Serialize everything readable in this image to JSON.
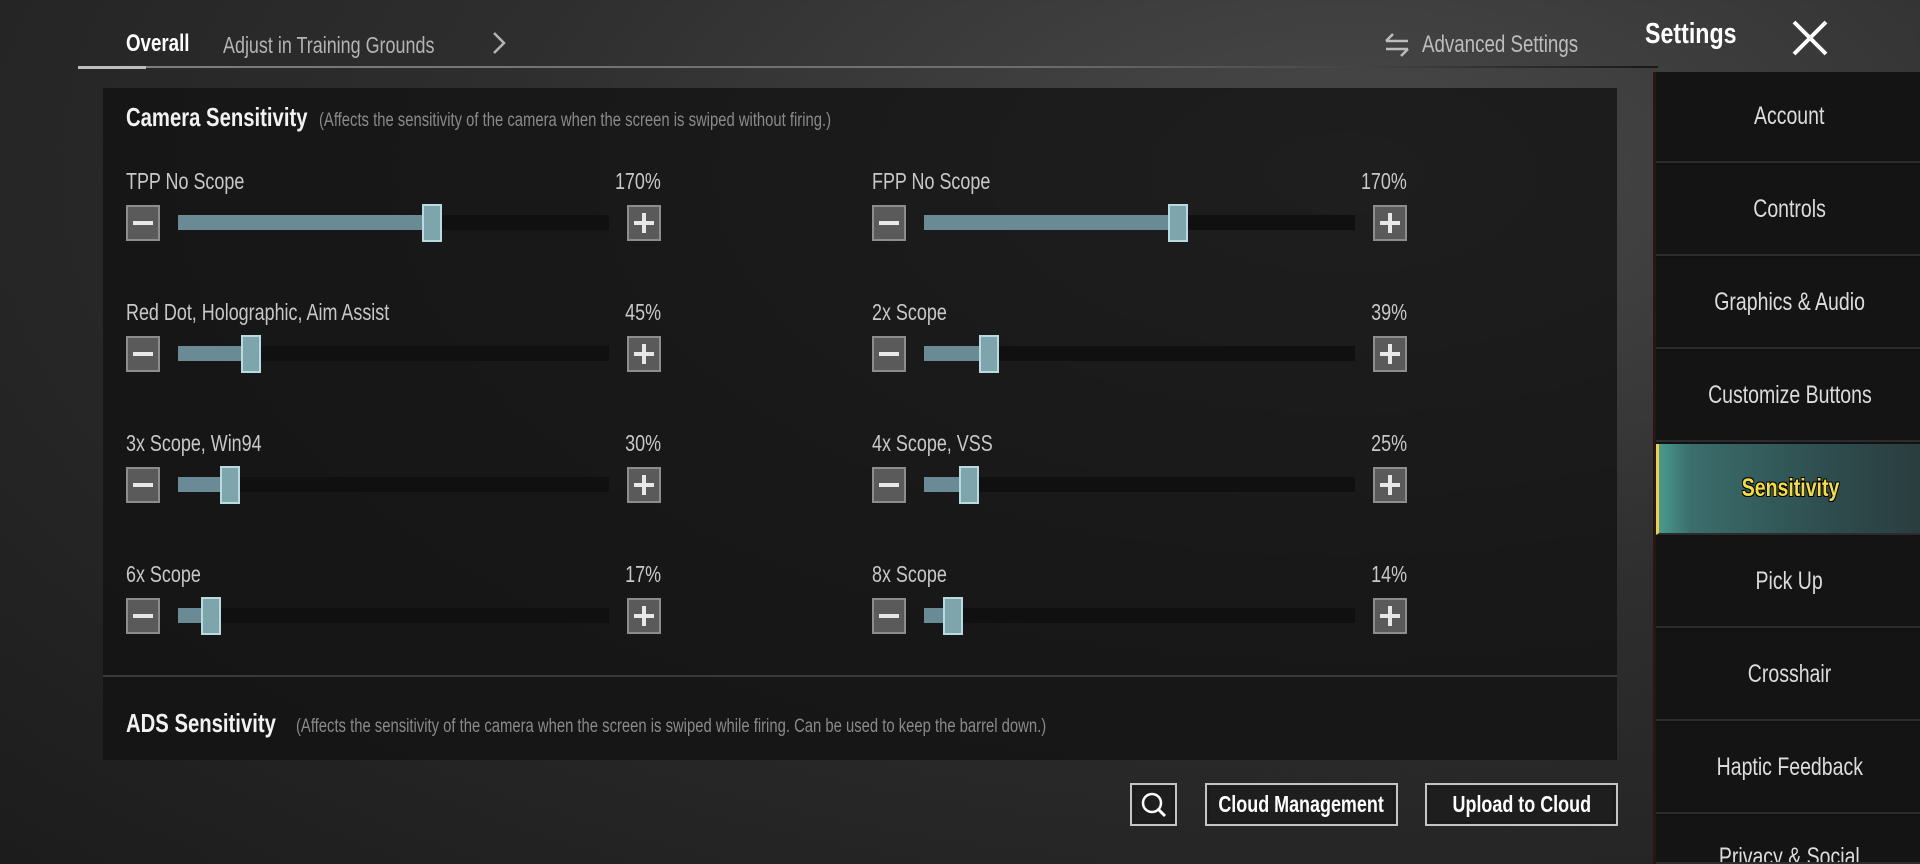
{
  "header": {
    "tabs": [
      {
        "label": "Overall",
        "active": true
      },
      {
        "label": "Adjust in Training Grounds",
        "active": false
      }
    ],
    "advanced_settings_label": "Advanced Settings",
    "title": "Settings"
  },
  "icons": {
    "chevron": "chevron-right-icon",
    "advanced": "swap-arrows-icon",
    "close": "close-x-icon",
    "search": "search-icon",
    "minus": "minus-icon",
    "plus": "plus-icon"
  },
  "camera_sensitivity": {
    "title": "Camera Sensitivity",
    "description": "(Affects the sensitivity of the camera when the screen is swiped without firing.)",
    "slider_max_percent": 300,
    "settings": [
      {
        "label": "TPP No Scope",
        "value_text": "170%",
        "value": 170
      },
      {
        "label": "FPP No Scope",
        "value_text": "170%",
        "value": 170
      },
      {
        "label": "Red Dot, Holographic, Aim Assist",
        "value_text": "45%",
        "value": 45
      },
      {
        "label": "2x Scope",
        "value_text": "39%",
        "value": 39
      },
      {
        "label": "3x Scope, Win94",
        "value_text": "30%",
        "value": 30
      },
      {
        "label": "4x Scope, VSS",
        "value_text": "25%",
        "value": 25
      },
      {
        "label": "6x Scope",
        "value_text": "17%",
        "value": 17
      },
      {
        "label": "8x Scope",
        "value_text": "14%",
        "value": 14
      }
    ]
  },
  "ads_sensitivity": {
    "title": "ADS Sensitivity",
    "description": "(Affects the sensitivity of the camera when the screen is swiped while firing. Can be used to keep the barrel down.)"
  },
  "footer": {
    "cloud_management_label": "Cloud Management",
    "upload_label": "Upload to Cloud"
  },
  "sidebar": {
    "items": [
      {
        "label": "Account",
        "active": false
      },
      {
        "label": "Controls",
        "active": false
      },
      {
        "label": "Graphics & Audio",
        "active": false
      },
      {
        "label": "Customize Buttons",
        "active": false
      },
      {
        "label": "Sensitivity",
        "active": true
      },
      {
        "label": "Pick Up",
        "active": false
      },
      {
        "label": "Crosshair",
        "active": false
      },
      {
        "label": "Haptic Feedback",
        "active": false
      },
      {
        "label": "Privacy & Social",
        "active": false
      }
    ]
  },
  "colors": {
    "accent_yellow": "#f6dd3c",
    "slider_fill": "#6a8b95",
    "slider_thumb": "#7ea4ac",
    "active_tab_bg": "#3a6e6c"
  }
}
